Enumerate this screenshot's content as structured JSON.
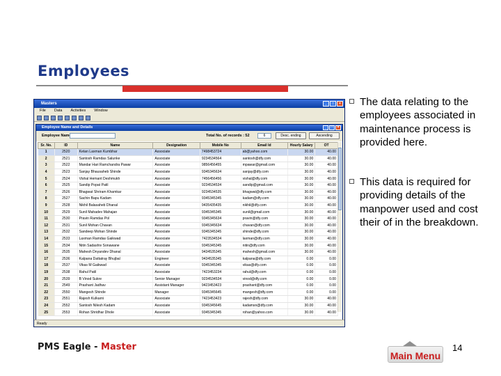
{
  "slide": {
    "title": "Employees",
    "bullets": [
      "The data relating to the employees associated in maintenance process is provided here.",
      "This data is required for providing details of the manpower used and cost their of in the breakdown."
    ],
    "footer_app": "PMS Eagle - ",
    "footer_section": "Master",
    "main_menu_label": "Main Menu",
    "page_number": "14"
  },
  "app": {
    "window_title": "Masters",
    "menu": [
      "File",
      "Data",
      "Activities",
      "Window"
    ],
    "form_title": "Employee Name and Details",
    "search_label": "Employee Name",
    "total_label": "Total No. of records : 52",
    "total_value": "6",
    "desc_button": "Desc. ending",
    "asc_button": "Ascending",
    "status_text": "Ready",
    "columns": [
      "Sr. No.",
      "ID",
      "Name",
      "Designation",
      "Mobile No",
      "Email Id",
      "Hourly Salary",
      "OT"
    ],
    "rows": [
      [
        "1",
        "2520",
        "Ketan Laxman Kumbhar",
        "Associate",
        "7498453724",
        "ab@yahoo.com",
        "30.00",
        "40.00"
      ],
      [
        "2",
        "2521",
        "Santosh Ramdas Salunke",
        "Associate",
        "9234534564",
        "santosh@dfy.com",
        "30.00",
        "40.00"
      ],
      [
        "3",
        "2522",
        "Mandar Hari Ramchandra Pawar",
        "Associate",
        "9856456455",
        "mpawar@gmail.com",
        "30.00",
        "40.00"
      ],
      [
        "4",
        "2523",
        "Sanjay Bhausaheb Shinde",
        "Associate",
        "9345345634",
        "sanjay@dfy.com",
        "30.00",
        "40.00"
      ],
      [
        "5",
        "2524",
        "Vishal Hemant Deshmukh",
        "Associate",
        "7456456456",
        "vishal@dfy.com",
        "30.00",
        "40.00"
      ],
      [
        "6",
        "2525",
        "Sandip Popat Patil",
        "Associate",
        "9234534534",
        "sandip@gmail.com",
        "30.00",
        "40.00"
      ],
      [
        "7",
        "2526",
        "Bhagwat Shriram Khamkar",
        "Associate",
        "9234534535",
        "bhagwat@dfy.com",
        "30.00",
        "40.00"
      ],
      [
        "8",
        "2527",
        "Sachin Bapu Kadam",
        "Associate",
        "9345345345",
        "kadam@dfy.com",
        "30.00",
        "40.00"
      ],
      [
        "9",
        "2528",
        "Nikhil Balasaheb Dhanal",
        "Associate",
        "9435435435",
        "nikhil@dfy.com",
        "30.00",
        "40.00"
      ],
      [
        "10",
        "2529",
        "Sunil Mahadev Mahajan",
        "Associate",
        "9345345345",
        "sunil@gmail.com",
        "30.00",
        "40.00"
      ],
      [
        "11",
        "2530",
        "Pravin Ramdas Pol",
        "Associate",
        "9345345634",
        "pravin@dfy.com",
        "30.00",
        "40.00"
      ],
      [
        "12",
        "2531",
        "Sunil Mohan Chavan",
        "Associate",
        "9345345634",
        "chavan@dfy.com",
        "30.00",
        "40.00"
      ],
      [
        "13",
        "2532",
        "Sandeep Mohan Shinde",
        "Associate",
        "9345345345",
        "shinde@dfy.com",
        "30.00",
        "40.00"
      ],
      [
        "14",
        "2533",
        "Laxman Ramdas Gaikwad",
        "Associate",
        "7423534534",
        "laxman@dfy.com",
        "30.00",
        "40.00"
      ],
      [
        "15",
        "2534",
        "Nitin Sadashiv Sonawane",
        "Associate",
        "9345345345",
        "nitin@dfy.com",
        "30.00",
        "40.00"
      ],
      [
        "16",
        "2535",
        "Mahesh Dnyandev Dhanal",
        "Associate",
        "9434535345",
        "mahesh@gmail.com",
        "30.00",
        "40.00"
      ],
      [
        "17",
        "2536",
        "Kalpana Dattatray Bhujbal",
        "Engineer",
        "9434535345",
        "kalpana@dfy.com",
        "0.00",
        "0.00"
      ],
      [
        "18",
        "2537",
        "Vikas M Gaikwad",
        "Associate",
        "9345345345",
        "vikas@dfy.com",
        "0.00",
        "0.00"
      ],
      [
        "19",
        "2538",
        "Rahul Patil",
        "Associate",
        "7423453234",
        "rahul@dfy.com",
        "0.00",
        "0.00"
      ],
      [
        "20",
        "2539",
        "B Vinod Sukre",
        "Senior Manager",
        "9234534534",
        "vinod@dfy.com",
        "0.00",
        "0.00"
      ],
      [
        "21",
        "2549",
        "Prashant Jadhav",
        "Assistant Manager",
        "9423453423",
        "prashant@dfy.com",
        "0.00",
        "0.00"
      ],
      [
        "22",
        "2550",
        "Mangesh Shinde",
        "Manager",
        "9345345645",
        "mangesh@dfy.com",
        "0.00",
        "0.00"
      ],
      [
        "23",
        "2551",
        "Rajesh Kulkarni",
        "Associate",
        "7423453423",
        "rajesh@dfy.com",
        "30.00",
        "40.00"
      ],
      [
        "24",
        "2552",
        "Santosh Nilesh Kadam",
        "Associate",
        "9345345645",
        "kadamsn@dfy.com",
        "30.00",
        "40.00"
      ],
      [
        "25",
        "2553",
        "Rohan Shridhar Dhole",
        "Associate",
        "9345345345",
        "rohan@yahoo.com",
        "30.00",
        "40.00"
      ]
    ]
  }
}
